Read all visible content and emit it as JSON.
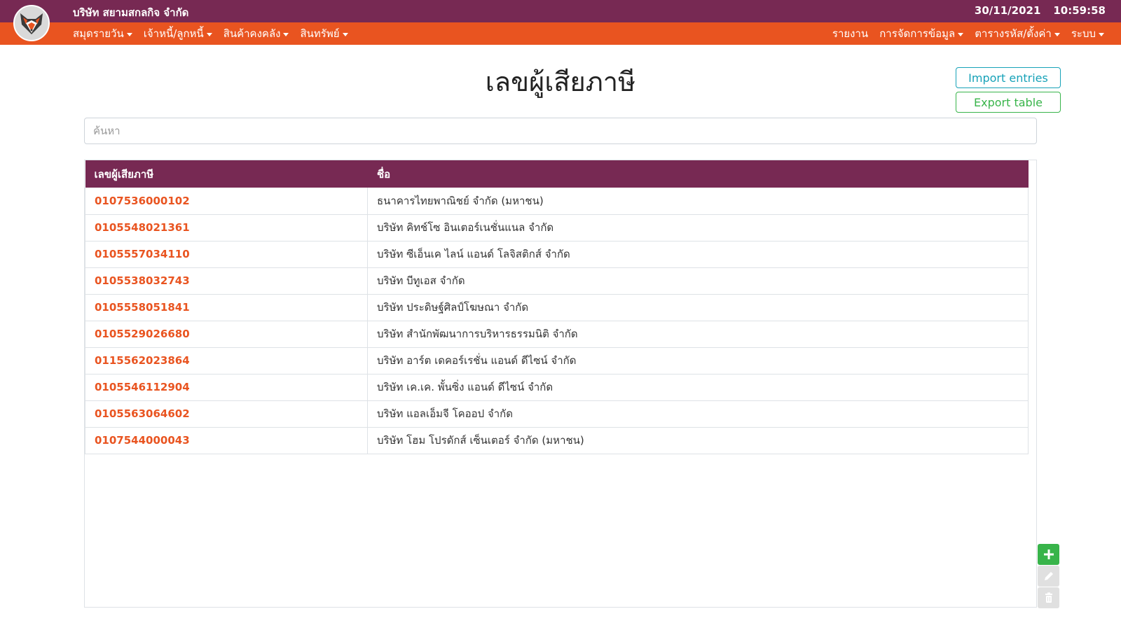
{
  "header": {
    "company": "บริษัท สยามสกลกิจ จำกัด",
    "date": "30/11/2021",
    "time": "10:59:58"
  },
  "nav": {
    "left": [
      {
        "label": "สมุดรายวัน",
        "dropdown": true
      },
      {
        "label": "เจ้าหนี้/ลูกหนี้",
        "dropdown": true
      },
      {
        "label": "สินค้าคงคลัง",
        "dropdown": true
      },
      {
        "label": "สินทรัพย์",
        "dropdown": true
      }
    ],
    "right": [
      {
        "label": "รายงาน",
        "dropdown": false
      },
      {
        "label": "การจัดการข้อมูล",
        "dropdown": true
      },
      {
        "label": "ตารางรหัส/ตั้งค่า",
        "dropdown": true
      },
      {
        "label": "ระบบ",
        "dropdown": true
      }
    ]
  },
  "page": {
    "title": "เลขผู้เสียภาษี",
    "import_label": "Import entries",
    "export_label": "Export table",
    "search_placeholder": "ค้นหา"
  },
  "table": {
    "headers": [
      "เลขผู้เสียภาษี",
      "ชื่อ"
    ],
    "rows": [
      {
        "tax_id": "0107536000102",
        "name": "ธนาคารไทยพาณิชย์ จำกัด (มหาชน)"
      },
      {
        "tax_id": "0105548021361",
        "name": "บริษัท คิทช์โซ อินเตอร์เนชั่นแนล จำกัด"
      },
      {
        "tax_id": "0105557034110",
        "name": "บริษัท ซีเอ็นเค ไลน์ แอนด์ โลจิสติกส์ จำกัด"
      },
      {
        "tax_id": "0105538032743",
        "name": "บริษัท บีทูเอส จำกัด"
      },
      {
        "tax_id": "0105558051841",
        "name": "บริษัท ประดิษฐ์ศิลป์โฆษณา จำกัด"
      },
      {
        "tax_id": "0105529026680",
        "name": "บริษัท สำนักพัฒนาการบริหารธรรมนิติ จำกัด"
      },
      {
        "tax_id": "0115562023864",
        "name": "บริษัท อาร์ต เดคอร์เรชั่น แอนด์ ดีไซน์ จำกัด"
      },
      {
        "tax_id": "0105546112904",
        "name": "บริษัท เค.เค. พั้นซิ่ง แอนด์ ดีไซน์ จำกัด"
      },
      {
        "tax_id": "0105563064602",
        "name": "บริษัท แอลเอ็มจี โคออป จำกัด"
      },
      {
        "tax_id": "0107544000043",
        "name": "บริษัท โฮม โปรดักส์ เซ็นเตอร์ จำกัด (มหาชน)"
      }
    ]
  },
  "side_buttons": {
    "add_icon": "plus-icon",
    "edit_icon": "pencil-icon",
    "delete_icon": "trash-icon"
  },
  "colors": {
    "header_bg": "#772953",
    "nav_bg": "#e95420",
    "accent": "#e95420",
    "success": "#38b44a",
    "info": "#17a2b8"
  }
}
